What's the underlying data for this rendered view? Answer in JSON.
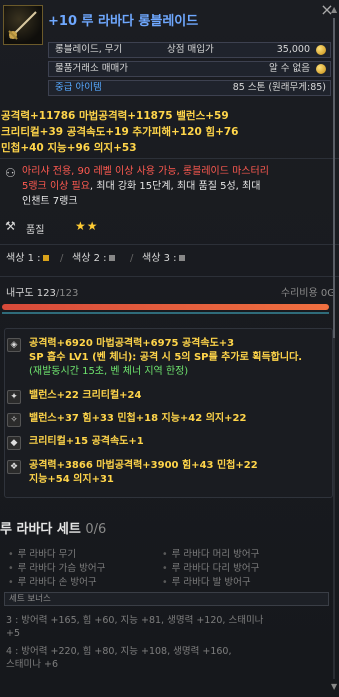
{
  "header": {
    "title": "+10 루 라바다 롱블레이드",
    "close": "×"
  },
  "info": {
    "type_label": "롱블레이드, 무기",
    "price_label": "상점 매입가",
    "price_value": "35,000",
    "trade_label": "물품거래소 매매가",
    "trade_value": "알 수 없음",
    "grade_label": "중급 아이템",
    "grade_value": "85 스톤 (원래무게:85)"
  },
  "stats_main": {
    "line1": "공격력+11786  마법공격력+11875  밸런스+59",
    "line2": "크리티컬+39  공격속도+19  추가피해+120  힘+76",
    "line3": "민첩+40  지능+96  의지+53"
  },
  "description": {
    "line1": "아리샤 전용, 90 레벨 이상 사용 가능, 롱블레이드 마스터리",
    "line2a": "5랭크 이상 필요",
    "line2b": ", 최대 강화 15단계, 최대 품질 5성, 최대",
    "line3": "인챈트 7랭크"
  },
  "quality": {
    "label": "품질",
    "stars": "★★"
  },
  "sockets": {
    "s1": "색상 1 :",
    "s2": "색상 2 :",
    "s3": "색상 3 :"
  },
  "durability": {
    "label": "내구도",
    "current": "123",
    "max": "/123",
    "repair": "수리비용 0G",
    "fraction": 1.0
  },
  "effects": {
    "e1_line1": "공격력+6920  마법공격력+6975  공격속도+3",
    "e1_line2": "SP 흡수 LV1 (벤 체너): 공격 시 5의 SP를 추가로 획득합니다.",
    "e1_line3": "(재발동시간 15초, 벤 체너 지역 한정)",
    "e2": "밸런스+22  크리티컬+24",
    "e3": "밸런스+37  힘+33  민첩+18  지능+42  의지+22",
    "e4": "크리티컬+15  공격속도+1",
    "e5_line1": "공격력+3866  마법공격력+3900  힘+43  민첩+22",
    "e5_line2": "지능+54  의지+31"
  },
  "set": {
    "title": "루 라바다 세트",
    "count": "0/6",
    "items": [
      "루 라바다 무기",
      "루 라바다 머리 방어구",
      "루 라바다 가슴 방어구",
      "루 라바다 다리 방어구",
      "루 라바다 손 방어구",
      "루 라바다 발 방어구"
    ],
    "bonus_label": "세트 보너스",
    "bonus3a": "3 : 방어력 +165, 힘 +60, 지능 +81, 생명력 +120, 스태미나",
    "bonus3b": "+5",
    "bonus4a": "4 : 방어력 +220, 힘 +80, 지능 +108, 생명력 +160,",
    "bonus4b": "스태미나 +6"
  },
  "colors": {
    "title": "#6fa8ff",
    "stats": "#ffd54a",
    "warning": "#ff5a50",
    "green_text": "#6ee36e"
  }
}
